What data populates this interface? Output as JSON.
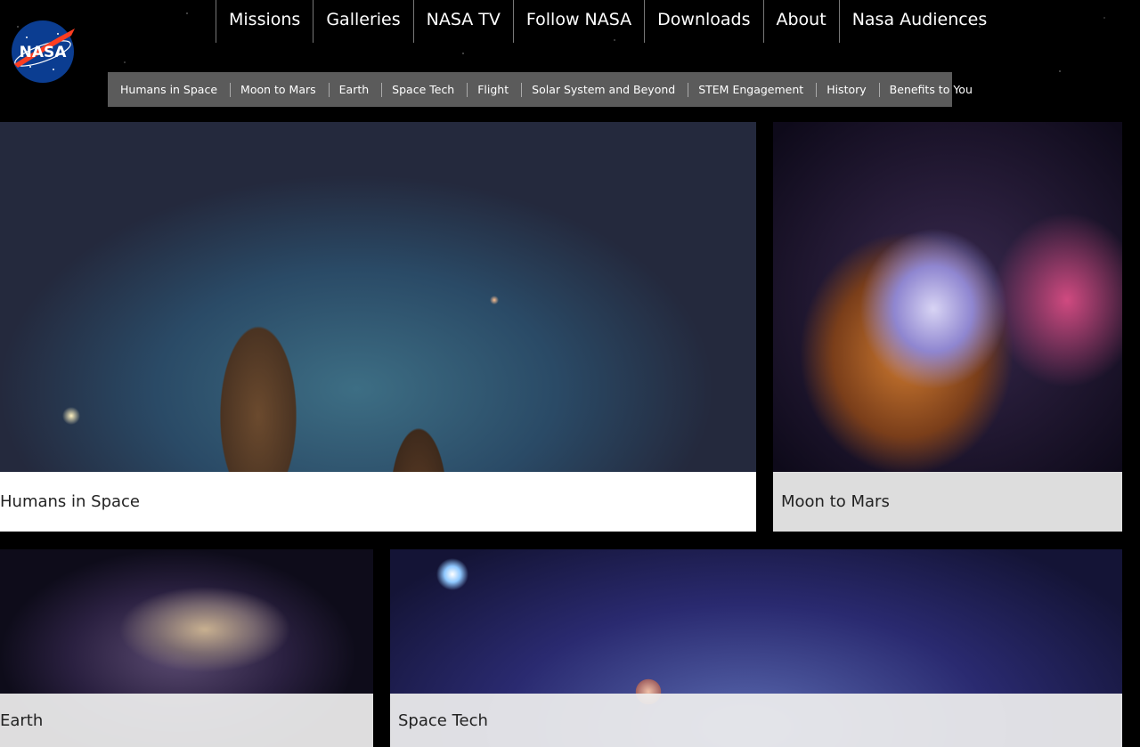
{
  "logo": {
    "text": "NASA"
  },
  "top_nav": [
    "Missions",
    "Galleries",
    "NASA TV",
    "Follow NASA",
    "Downloads",
    "About",
    "Nasa Audiences"
  ],
  "sub_nav": [
    "Humans in Space",
    "Moon to Mars",
    "Earth",
    "Space Tech",
    "Flight",
    "Solar System and Beyond",
    "STEM Engagement",
    "History",
    "Benefits to You"
  ],
  "cards": {
    "humans_in_space": "Humans in Space",
    "moon_to_mars": "Moon to Mars",
    "earth": "Earth",
    "space_tech": "Space Tech"
  },
  "colors": {
    "background": "#000000",
    "subnav_bg": "#5b5b5b",
    "logo_blue": "#0b3d91",
    "logo_red": "#fc3d21"
  }
}
